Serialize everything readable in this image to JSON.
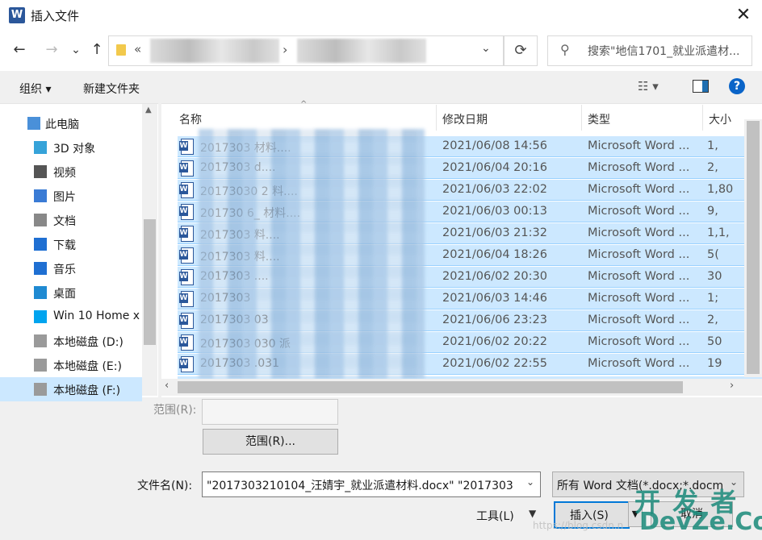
{
  "window": {
    "title": "插入文件",
    "close_label": "✕",
    "app_icon_letter": "W",
    "accent": "#2b579a"
  },
  "nav": {
    "back": "←",
    "forward": "→",
    "recent": "⌄",
    "up": "↑",
    "address_prefix": "«",
    "address_separator": "›",
    "address_dropdown": "⌄",
    "refresh": "⟳",
    "search_icon": "⚲",
    "search_placeholder": "搜索\"地信1701_就业派遣材..."
  },
  "toolbar": {
    "organize": "组织 ▾",
    "new_folder": "新建文件夹",
    "view_icon": "☷ ▾",
    "help": "?"
  },
  "sidebar": {
    "items": [
      {
        "label": "此电脑",
        "icon": "computer-icon"
      },
      {
        "label": "3D 对象",
        "icon": "cube-icon"
      },
      {
        "label": "视频",
        "icon": "video-icon"
      },
      {
        "label": "图片",
        "icon": "picture-icon"
      },
      {
        "label": "文档",
        "icon": "document-icon"
      },
      {
        "label": "下载",
        "icon": "download-icon"
      },
      {
        "label": "音乐",
        "icon": "music-icon"
      },
      {
        "label": "桌面",
        "icon": "desktop-icon"
      },
      {
        "label": "Win 10 Home x",
        "icon": "windows-drive-icon"
      },
      {
        "label": "本地磁盘 (D:)",
        "icon": "drive-icon"
      },
      {
        "label": "本地磁盘 (E:)",
        "icon": "drive-icon"
      },
      {
        "label": "本地磁盘 (F:)",
        "icon": "drive-icon"
      }
    ],
    "selected_index": 11
  },
  "columns": {
    "name": "名称",
    "date": "修改日期",
    "type": "类型",
    "size": "大小"
  },
  "files": [
    {
      "name": "2017303                    材料....",
      "date": "2021/06/08 14:56",
      "type": "Microsoft Word ...",
      "size": "1,"
    },
    {
      "name": "2017303                       d....",
      "date": "2021/06/04 20:16",
      "type": "Microsoft Word ...",
      "size": "2,"
    },
    {
      "name": "20173030          2          料....",
      "date": "2021/06/03 22:02",
      "type": "Microsoft Word ...",
      "size": "1,80"
    },
    {
      "name": "201730       6_          材料....",
      "date": "2021/06/03 00:13",
      "type": "Microsoft Word ...",
      "size": "9,"
    },
    {
      "name": "2017303                     料....",
      "date": "2021/06/03 21:32",
      "type": "Microsoft Word ...",
      "size": "1,1,"
    },
    {
      "name": "2017303                     料....",
      "date": "2021/06/04 18:26",
      "type": "Microsoft Word ...",
      "size": "5("
    },
    {
      "name": "2017303                        ....",
      "date": "2021/06/02 20:30",
      "type": "Microsoft Word ...",
      "size": "30"
    },
    {
      "name": "2017303                         ",
      "date": "2021/06/03 14:46",
      "type": "Microsoft Word ...",
      "size": "1;"
    },
    {
      "name": "2017303       03                 ",
      "date": "2021/06/06 23:23",
      "type": "Microsoft Word ...",
      "size": "2,"
    },
    {
      "name": "2017303       030        派       ",
      "date": "2021/06/02 20:22",
      "type": "Microsoft Word ...",
      "size": "50"
    },
    {
      "name": "2017303       .031                 ",
      "date": "2021/06/02 22:55",
      "type": "Microsoft Word ...",
      "size": "19"
    }
  ],
  "bottom": {
    "range_label": "范围(R):",
    "range_button": "范围(R)...",
    "filename_label": "文件名(N):",
    "filename_value": "\"2017303210104_汪婧宇_就业派遣材料.docx\" \"2017303",
    "filter_value": "所有 Word 文档(*.docx;*.docm",
    "tools": "工具(L)",
    "insert": "插入(S)",
    "cancel": "取消",
    "dropdown": "⌄"
  },
  "watermark": {
    "big": "开 发 者",
    "big2": "DevZe.CoM",
    "small": "https://blog.csdn.n"
  }
}
